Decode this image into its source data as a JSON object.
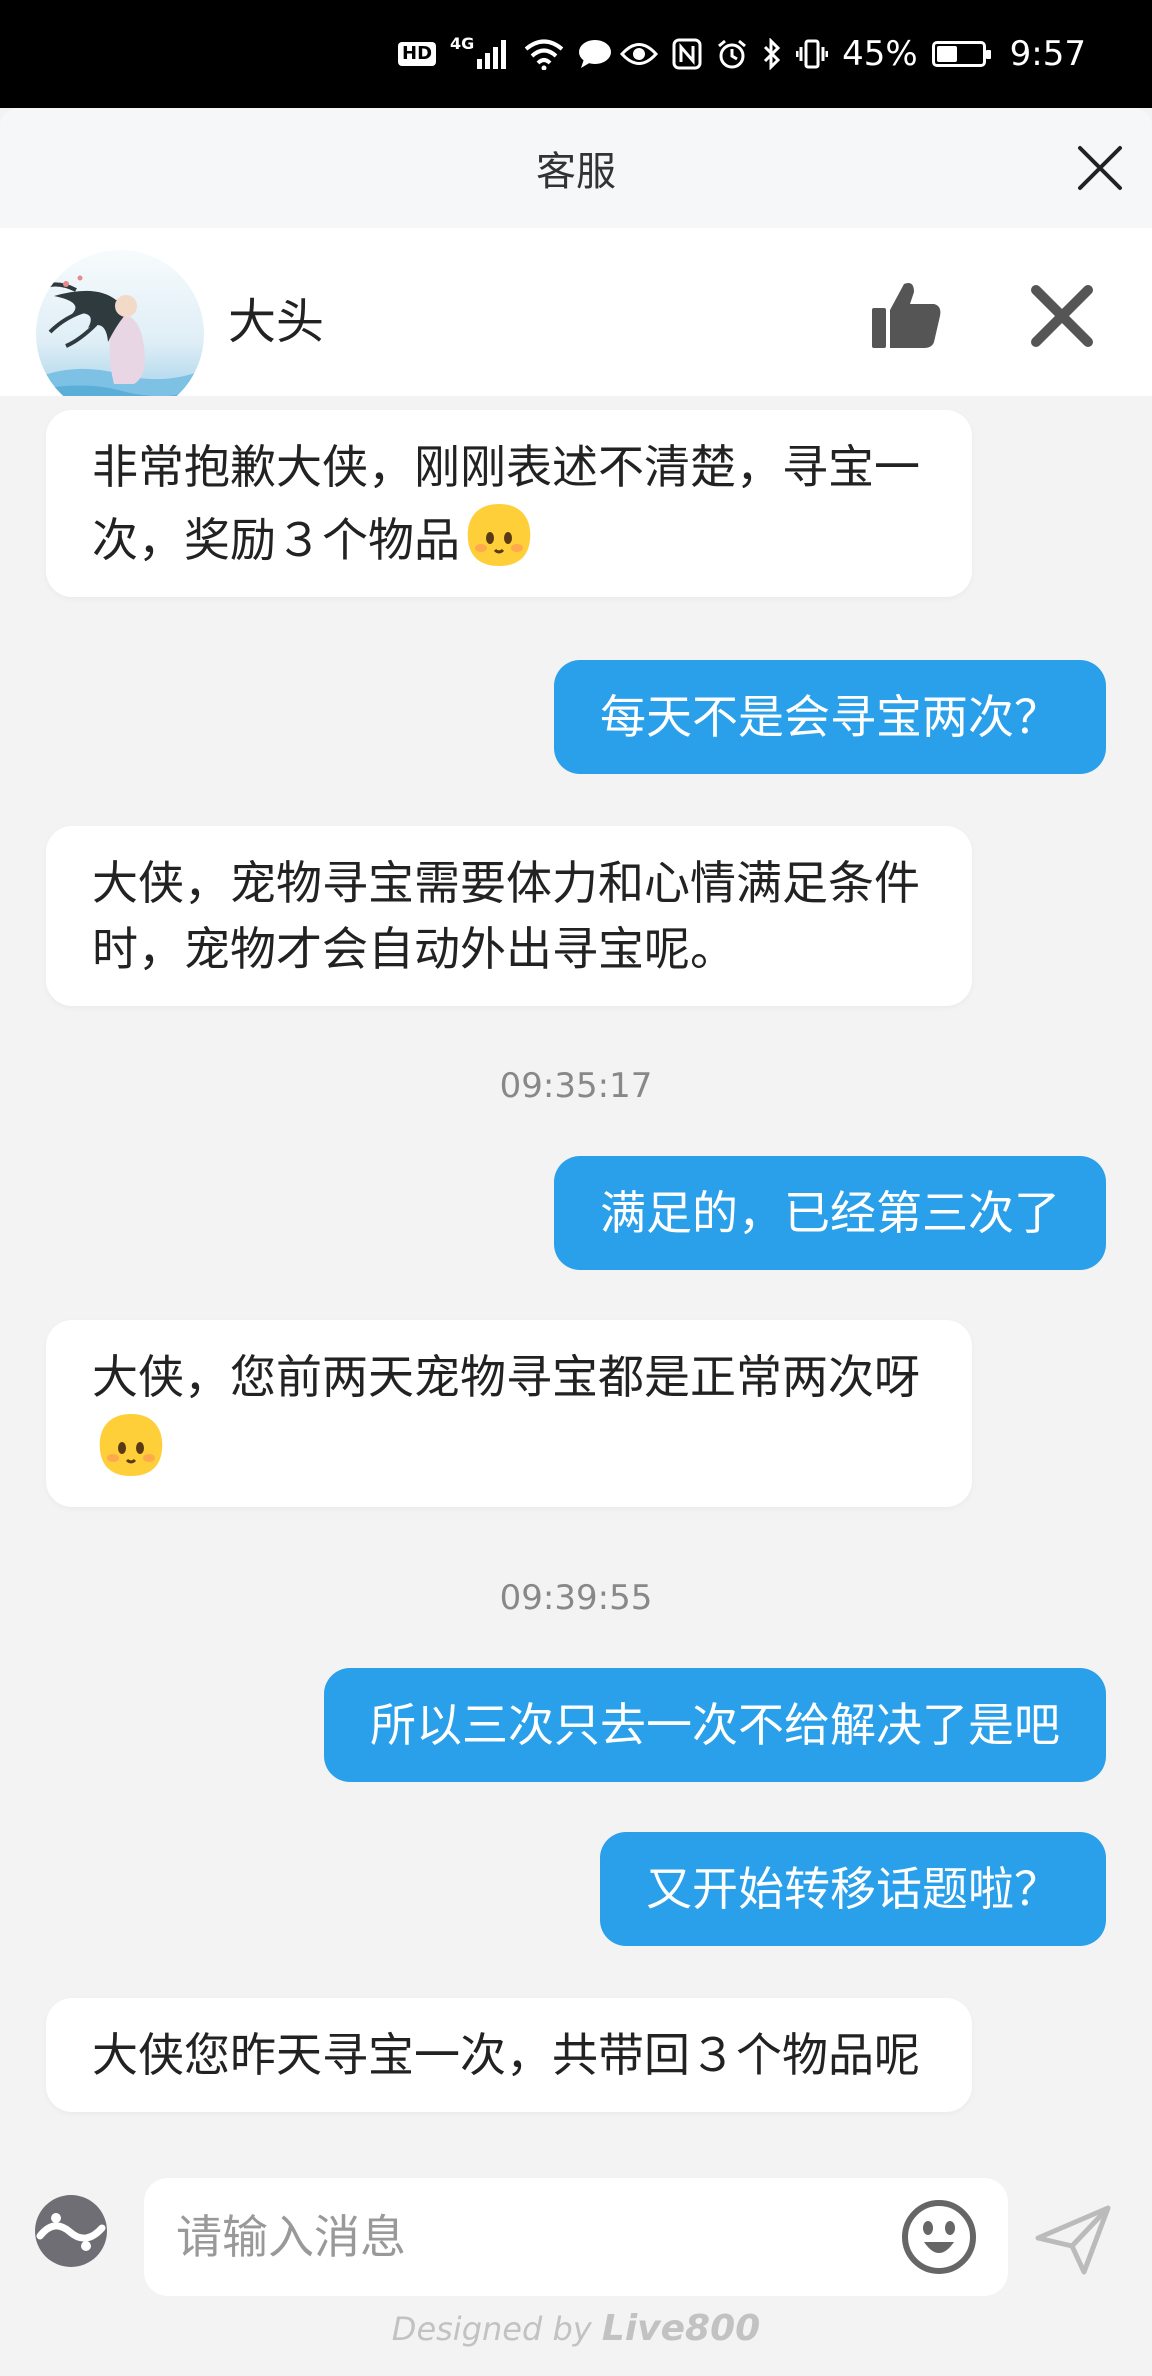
{
  "status_bar": {
    "hd": "HD",
    "network": "4G",
    "battery_percent": "45%",
    "battery_level": 0.45,
    "time": "9:57"
  },
  "title_bar": {
    "title": "客服"
  },
  "agent": {
    "name": "大头"
  },
  "messages": [
    {
      "from": "agent",
      "text": "非常抱歉大侠，刚刚表述不清楚，寻宝一次，奖励３个物品",
      "emoji": true
    },
    {
      "from": "user",
      "text": "每天不是会寻宝两次？"
    },
    {
      "from": "agent",
      "text": "大侠，宠物寻宝需要体力和心情满足条件时，宠物才会自动外出寻宝呢。"
    },
    {
      "from": "timestamp",
      "text": "09:35:17"
    },
    {
      "from": "user",
      "text": "满足的，已经第三次了"
    },
    {
      "from": "agent",
      "text": "大侠，您前两天宠物寻宝都是正常两次呀",
      "emoji": true
    },
    {
      "from": "timestamp",
      "text": "09:39:55"
    },
    {
      "from": "user",
      "text": "所以三次只去一次不给解决了是吧"
    },
    {
      "from": "user",
      "text": "又开始转移话题啦？"
    },
    {
      "from": "agent",
      "text": "大侠您昨天寻宝一次，共带回３个物品呢"
    }
  ],
  "input": {
    "placeholder": "请输入消息",
    "value": ""
  },
  "footer": {
    "prefix": "Designed by ",
    "brand": "Live800"
  },
  "colors": {
    "user_bubble": "#2aa0ea",
    "agent_bubble": "#ffffff",
    "background": "#f3f3f4"
  }
}
